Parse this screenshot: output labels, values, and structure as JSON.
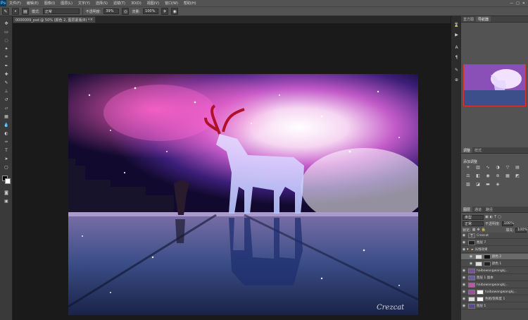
{
  "app": {
    "logo": "Ps"
  },
  "menu": [
    "文件(F)",
    "编辑(E)",
    "图像(I)",
    "图层(L)",
    "文字(Y)",
    "选择(S)",
    "滤镜(T)",
    "3D(D)",
    "视图(V)",
    "窗口(W)",
    "帮助(H)"
  ],
  "window_controls": [
    "—",
    "□",
    "✕"
  ],
  "options": {
    "mode_label": "模式:",
    "mode_value": "正常",
    "opacity_label": "不透明度:",
    "opacity_value": "39%",
    "flow_label": "流量:",
    "flow_value": "100%"
  },
  "document": {
    "tab_title": "0000009_psd @ 50% (颜色 2, 图层蒙版/8) *",
    "close": "×"
  },
  "panels": {
    "top_tabs": [
      "直方图",
      "导航器"
    ],
    "adjust_tabs": [
      "调整",
      "样式"
    ],
    "adjust_title": "添加调整",
    "layer_tabs": [
      "图层",
      "通道",
      "路径"
    ],
    "kind_label": "类型",
    "blend_value": "正常",
    "opacity_label": "不透明度:",
    "opacity_value": "100%",
    "lock_label": "锁定:",
    "fill_label": "填充:",
    "fill_value": "100%"
  },
  "layers": [
    {
      "name": "Crezcat",
      "type": "text"
    },
    {
      "name": "图层 7",
      "type": "image"
    },
    {
      "name": "光线效果",
      "type": "group"
    },
    {
      "name": "颜色 2",
      "type": "mask",
      "selected": true
    },
    {
      "name": "颜色 1",
      "type": "mask"
    },
    {
      "name": "haibowangwangkj...",
      "type": "image"
    },
    {
      "name": "图层 1 副本",
      "type": "image"
    },
    {
      "name": "haibowangwangkj...",
      "type": "image"
    },
    {
      "name": "haibowangwangkj...",
      "type": "image"
    },
    {
      "name": "色相/饱和度 1",
      "type": "mask"
    },
    {
      "name": "图层 1",
      "type": "image"
    }
  ],
  "colors": {
    "foreground": "#000000",
    "background": "#ffffff",
    "nav_highlight": "#dd3333"
  }
}
